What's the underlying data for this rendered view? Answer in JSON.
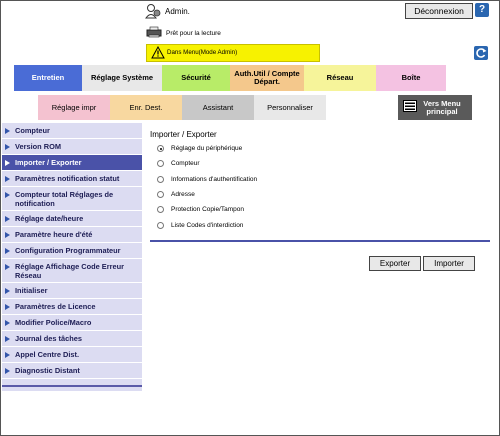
{
  "header": {
    "user_label": "Admin.",
    "logout_label": "Déconnexion",
    "help_label": "?",
    "status_text": "Prêt pour la lecture",
    "warning_text": "Dans Menu(Mode Admin)"
  },
  "tabs_row1": [
    {
      "label": "Entretien",
      "color": "#4a6cd6",
      "text_color": "#ffffff",
      "active": true
    },
    {
      "label": "Réglage Système",
      "color": "#e8e8e8",
      "text_color": "#000000"
    },
    {
      "label": "Sécurité",
      "color": "#b8ec68",
      "text_color": "#000000"
    },
    {
      "label": "Auth.Util / Compte Départ.",
      "color": "#f4c88c",
      "text_color": "#000000"
    },
    {
      "label": "Réseau",
      "color": "#f6f49a",
      "text_color": "#000000"
    },
    {
      "label": "Boîte",
      "color": "#f4c2e2",
      "text_color": "#000000"
    }
  ],
  "tabs_row2": [
    {
      "label": "Réglage impr",
      "color": "#f4c2d0"
    },
    {
      "label": "Enr. Dest.",
      "color": "#f8d8a0"
    },
    {
      "label": "Assistant",
      "color": "#c8c8c8"
    },
    {
      "label": "Personnaliser",
      "color": "#e8e8e8"
    },
    {
      "label": "Vers Menu principal",
      "color": "#5a5a5a"
    }
  ],
  "menu": [
    "Compteur",
    "Version ROM",
    "Importer / Exporter",
    "Paramètres notification statut",
    "Compteur total Réglages de notification",
    "Réglage date/heure",
    "Paramètre heure d'été",
    "Configuration Programmateur",
    "Réglage Affichage Code Erreur Réseau",
    "Initialiser",
    "Paramètres de Licence",
    "Modifier Police/Macro",
    "Journal des tâches",
    "Appel Centre Dist.",
    "Diagnostic Distant"
  ],
  "main": {
    "title": "Importer / Exporter",
    "options": [
      {
        "label": "Réglage du périphérique",
        "selected": true
      },
      {
        "label": "Compteur",
        "selected": false
      },
      {
        "label": "Informations d'authentification",
        "selected": false
      },
      {
        "label": "Adresse",
        "selected": false
      },
      {
        "label": "Protection Copie/Tampon",
        "selected": false
      },
      {
        "label": "Liste Codes d'interdiction",
        "selected": false
      }
    ],
    "export_label": "Exporter",
    "import_label": "Importer"
  },
  "colors": {
    "accent": "#4a52a8",
    "menu_bg": "#dcdcf2",
    "warning": "#f7f200"
  }
}
